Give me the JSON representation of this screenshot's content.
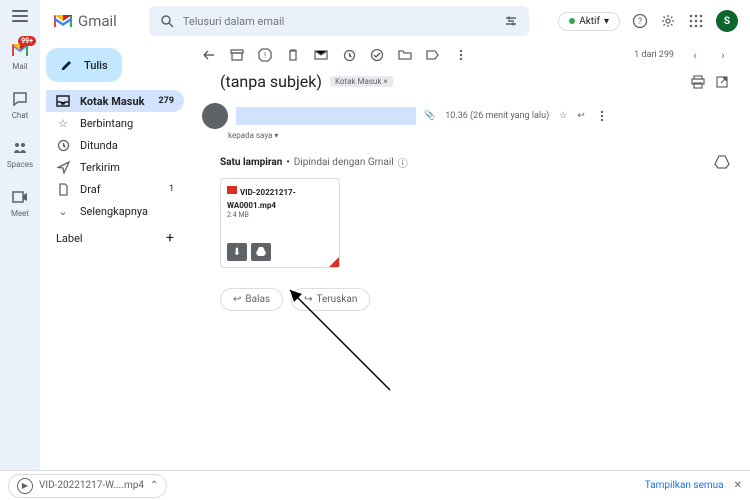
{
  "app": {
    "name": "Gmail"
  },
  "search": {
    "placeholder": "Telusuri dalam email"
  },
  "status": {
    "label": "Aktif"
  },
  "avatar": {
    "initial": "S"
  },
  "rail": {
    "mail": "Mail",
    "chat": "Chat",
    "spaces": "Spaces",
    "meet": "Meet",
    "badge": "99+"
  },
  "compose": {
    "label": "Tulis"
  },
  "nav": {
    "inbox": {
      "label": "Kotak Masuk",
      "count": "279"
    },
    "starred": {
      "label": "Berbintang"
    },
    "snoozed": {
      "label": "Ditunda"
    },
    "sent": {
      "label": "Terkirim"
    },
    "drafts": {
      "label": "Draf",
      "count": "1"
    },
    "more": {
      "label": "Selengkapnya"
    }
  },
  "labels": {
    "header": "Label"
  },
  "pager": {
    "text": "1 dari 299"
  },
  "subject": {
    "text": "(tanpa subjek)",
    "chip": "Kotak Masuk"
  },
  "sender": {
    "to": "kepada saya"
  },
  "message": {
    "time": "10.36 (26 menit yang lalu)"
  },
  "attachments": {
    "header": "Satu lampiran",
    "scanned": "Dipindai dengan Gmail",
    "file": {
      "name": "VID-20221217-WA0001.mp4",
      "size": "2.4 MB"
    }
  },
  "actions": {
    "reply": "Balas",
    "forward": "Teruskan"
  },
  "download": {
    "file": "VID-20221217-W....mp4",
    "showall": "Tampilkan semua"
  }
}
